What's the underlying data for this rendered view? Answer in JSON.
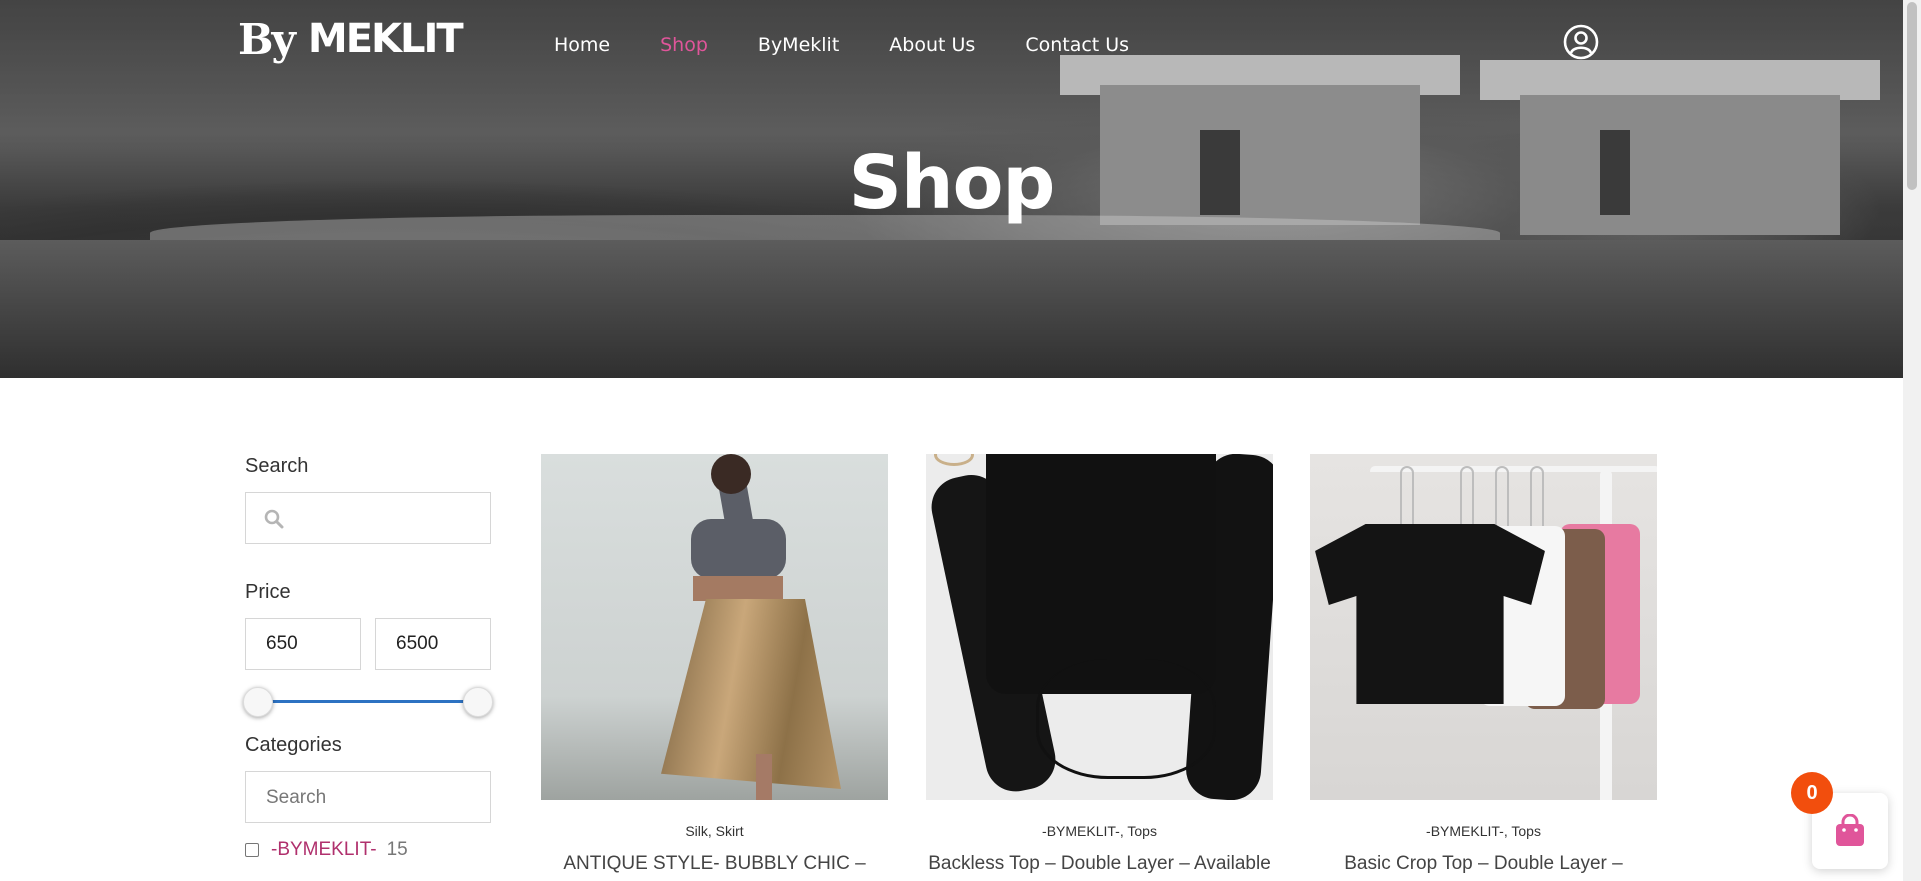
{
  "header": {
    "logo_text_by": "By",
    "logo_text_name": "MEKLIT",
    "nav": [
      {
        "label": "Home",
        "active": false
      },
      {
        "label": "Shop",
        "active": true
      },
      {
        "label": "ByMeklit",
        "active": false
      },
      {
        "label": "About Us",
        "active": false
      },
      {
        "label": "Contact Us",
        "active": false
      }
    ],
    "user_icon": "user-circle-icon"
  },
  "hero": {
    "title": "Shop"
  },
  "sidebar": {
    "search_label": "Search",
    "search_value": "",
    "price_label": "Price",
    "price_min": "650",
    "price_max": "6500",
    "categories_label": "Categories",
    "categories_search_placeholder": "Search",
    "categories": [
      {
        "name": "-BYMEKLIT-",
        "count": "15",
        "checked": false
      }
    ]
  },
  "products": [
    {
      "categories": "Silk,  Skirt",
      "title": "ANTIQUE STYLE- BUBBLY CHIC –"
    },
    {
      "categories": "-BYMEKLIT-,  Tops",
      "title": "Backless Top – Double Layer – Available"
    },
    {
      "categories": "-BYMEKLIT-,  Tops",
      "title": "Basic Crop Top – Double Layer – Available"
    }
  ],
  "cart": {
    "count": "0",
    "icon": "shopping-bag-icon",
    "accent": "#e0559a",
    "badge_color": "#f24e0d"
  },
  "colors": {
    "accent": "#e0559a",
    "category_link": "#b0306d",
    "slider": "#2d72c2"
  }
}
